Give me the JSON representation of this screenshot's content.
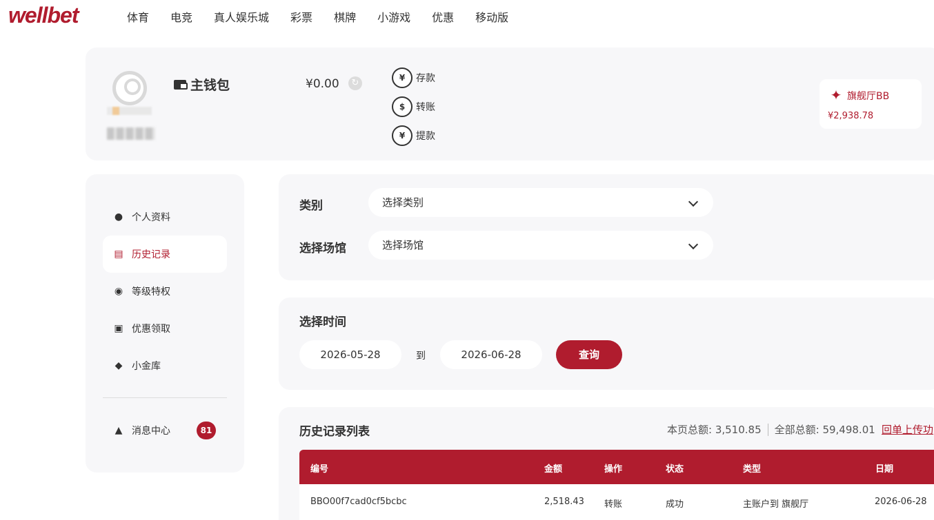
{
  "brand": {
    "logo": "wellbet",
    "accent": "#b01c2e"
  },
  "nav": [
    "体育",
    "电竞",
    "真人娱乐城",
    "彩票",
    "棋牌",
    "小游戏",
    "优惠",
    "移动版"
  ],
  "wallet": {
    "title": "主钱包",
    "balance": "¥0.00",
    "actions": [
      "存款",
      "转账",
      "提款"
    ],
    "venue": {
      "name": "旗舰厅BB",
      "amount": "¥2,938.78"
    }
  },
  "sidebar": {
    "items": [
      {
        "label": "个人资料",
        "icon": "user-icon"
      },
      {
        "label": "历史记录",
        "icon": "document-icon",
        "active": true
      },
      {
        "label": "等级特权",
        "icon": "medal-icon"
      },
      {
        "label": "优惠领取",
        "icon": "gift-icon"
      },
      {
        "label": "小金库",
        "icon": "diamond-icon"
      }
    ],
    "messages": {
      "label": "消息中心",
      "icon": "bell-icon",
      "count": "81"
    }
  },
  "filters": {
    "category_label": "类别",
    "category_placeholder": "选择类别",
    "venue_label": "选择场馆",
    "venue_placeholder": "选择场馆"
  },
  "time": {
    "title": "选择时间",
    "start": "2026-05-28",
    "to": "到",
    "end": "2026-06-28",
    "query": "查询"
  },
  "history": {
    "title": "历史记录列表",
    "page_total": "本页总额: 3,510.85",
    "all_total": "全部总额: 59,498.01",
    "callback_link": "回单上传功",
    "columns": [
      "编号",
      "金额",
      "操作",
      "状态",
      "类型",
      "日期"
    ],
    "rows": [
      [
        "BBO00f7cad0cf5bcbc",
        "2,518.43",
        "转账",
        "成功",
        "主账户到 旗舰厅",
        "2026-06-28"
      ]
    ]
  }
}
